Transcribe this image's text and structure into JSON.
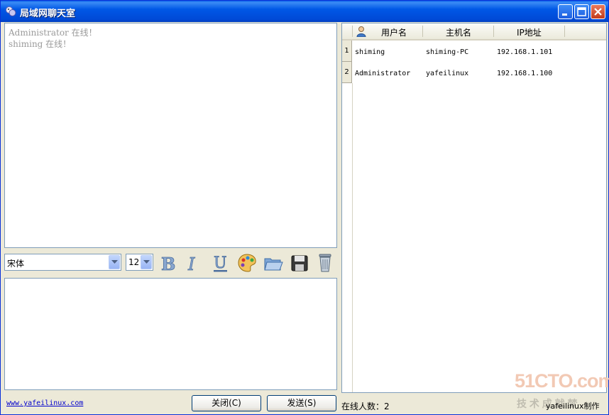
{
  "window": {
    "title": "局域网聊天室"
  },
  "chat": {
    "messages": [
      "Administrator 在线！",
      "shiming 在线！"
    ]
  },
  "toolbar": {
    "font": "宋体",
    "size": "12",
    "icons": [
      "bold-icon",
      "italic-icon",
      "underline-icon",
      "palette-icon",
      "folder-icon",
      "save-icon",
      "trash-icon"
    ]
  },
  "footer": {
    "link": "www.yafeilinux.com",
    "close_button": "关闭(C)",
    "send_button": "发送(S)"
  },
  "userlist": {
    "columns": [
      "用户名",
      "主机名",
      "IP地址"
    ],
    "rows": [
      {
        "index": "1",
        "user": "shiming",
        "host": "shiming-PC",
        "ip": "192.168.1.101"
      },
      {
        "index": "2",
        "user": "Administrator",
        "host": "yafeilinux",
        "ip": "192.168.1.100"
      }
    ]
  },
  "status": {
    "online_count": "在线人数：2",
    "credit": "yafeilinux制作"
  },
  "watermark": {
    "brand": "51CTO.com",
    "tagline": "技 术 成 就 梦"
  }
}
